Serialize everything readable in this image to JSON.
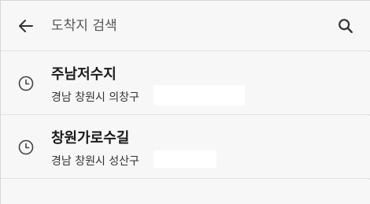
{
  "header": {
    "search_placeholder": "도착지 검색",
    "back_icon": "arrow-left-icon",
    "search_icon": "search-icon"
  },
  "history": [
    {
      "title": "주남저수지",
      "subtitle": "경남 창원시 의창구",
      "icon": "clock-icon"
    },
    {
      "title": "창원가로수길",
      "subtitle": "경남 창원시 성산구",
      "icon": "clock-icon"
    }
  ],
  "colors": {
    "background": "#f7f7f7",
    "divider": "#e2e2e2",
    "text": "#222222",
    "icon": "#333333"
  }
}
